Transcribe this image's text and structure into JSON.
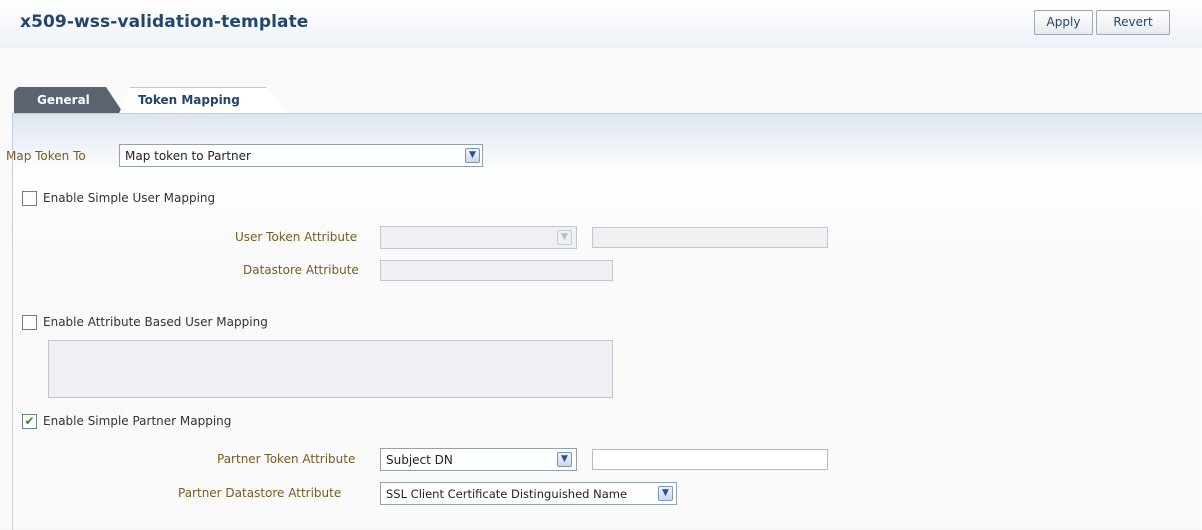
{
  "header": {
    "title": "x509-wss-validation-template",
    "apply_label": "Apply",
    "revert_label": "Revert"
  },
  "tabs": [
    {
      "label": "General",
      "active": false
    },
    {
      "label": "Token Mapping",
      "active": true
    }
  ],
  "form": {
    "map_token_to": {
      "label": "Map Token To",
      "value": "Map token to Partner"
    },
    "simple_user_mapping": {
      "label": "Enable Simple User Mapping",
      "checked": false,
      "user_token_attribute_label": "User Token Attribute",
      "user_token_attribute_value": "",
      "user_token_attribute_text": "",
      "datastore_attribute_label": "Datastore Attribute",
      "datastore_attribute_value": ""
    },
    "attribute_based_user_mapping": {
      "label": "Enable Attribute Based User Mapping",
      "checked": false,
      "textarea_value": ""
    },
    "simple_partner_mapping": {
      "label": "Enable Simple Partner Mapping",
      "checked": true,
      "checkmark": "✔",
      "partner_token_attribute_label": "Partner Token Attribute",
      "partner_token_attribute_value": "Subject DN",
      "partner_token_attribute_text": "",
      "partner_datastore_attribute_label": "Partner Datastore Attribute",
      "partner_datastore_attribute_value": "SSL Client Certificate Distinguished Name"
    }
  },
  "icons": {
    "dropdown": "chevron-down-icon",
    "dropdown_glyph": "▼"
  },
  "colors": {
    "title": "#23466e",
    "label": "#7a5b22",
    "active_tab_bg": "#ffffff",
    "inactive_tab_bg": "#5b6270",
    "checkmark": "#2e8a2e"
  }
}
